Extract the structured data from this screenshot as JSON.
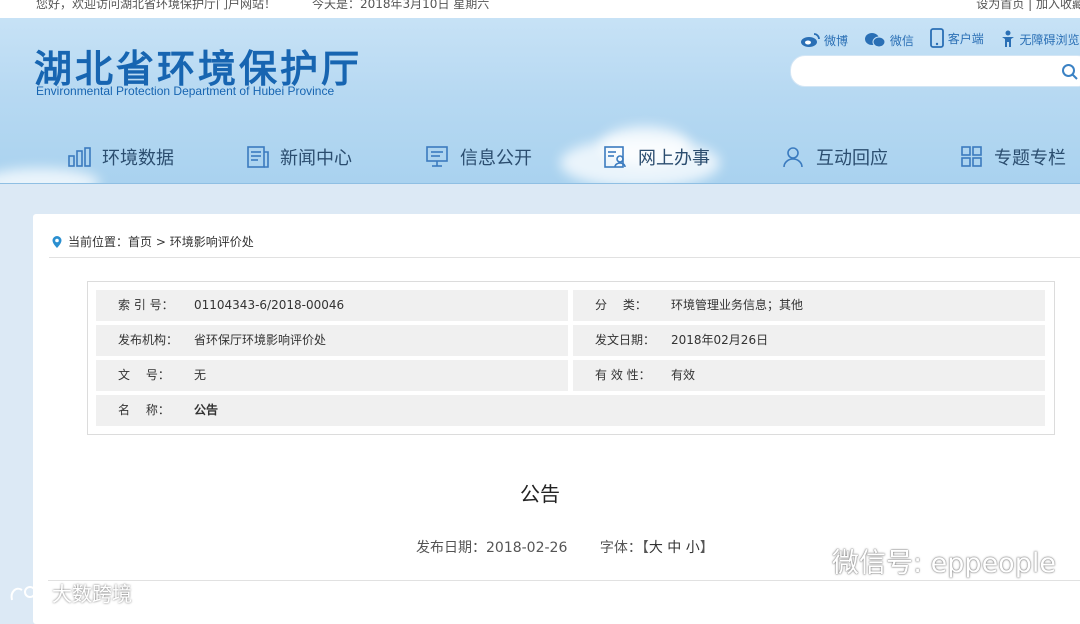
{
  "topbar": {
    "welcome": "您好，欢迎访问湖北省环境保护厅门户网站！",
    "date": "今天是：2018年3月10日 星期六",
    "set_home": "设为首页",
    "separator": " | ",
    "add_fav": "加入收藏"
  },
  "header": {
    "title": "湖北省环境保护厅",
    "subtitle": "Environmental Protection Department of Hubei Province",
    "quicklinks": [
      {
        "label": "微博",
        "icon": "weibo-icon"
      },
      {
        "label": "微信",
        "icon": "wechat-icon"
      },
      {
        "label": "客户端",
        "icon": "mobile-icon"
      },
      {
        "label": "无障碍浏览",
        "icon": "accessibility-icon"
      }
    ],
    "search_placeholder": ""
  },
  "nav": {
    "items": [
      {
        "label": "环境数据",
        "icon": "bar-chart-icon"
      },
      {
        "label": "新闻中心",
        "icon": "news-icon"
      },
      {
        "label": "信息公开",
        "icon": "monitor-icon"
      },
      {
        "label": "网上办事",
        "icon": "id-card-icon"
      },
      {
        "label": "互动回应",
        "icon": "user-icon"
      },
      {
        "label": "专题专栏",
        "icon": "grid-icon"
      }
    ]
  },
  "breadcrumb": {
    "prefix": "当前位置：",
    "home": "首页",
    "sep": " > ",
    "current": "环境影响评价处"
  },
  "info": {
    "index_label": "索 引 号：",
    "index_value": "01104343-6/2018-00046",
    "category_label": "分　 类：",
    "category_value": "环境管理业务信息；其他",
    "publisher_label": "发布机构：",
    "publisher_value": "省环保厅环境影响评价处",
    "date_label": "发文日期：",
    "date_value": "2018年02月26日",
    "docno_label": "文　 号：",
    "docno_value": "无",
    "validity_label": "有 效 性：",
    "validity_value": "有效",
    "name_label": "名　 称：",
    "name_value": "公告"
  },
  "document": {
    "title": "公告",
    "publish_date": "发布日期：2018-02-26",
    "font_label": "字体：",
    "font_open": "【",
    "font_large": "大",
    "font_medium": "中",
    "font_small": "小",
    "font_close": "】"
  },
  "watermarks": {
    "wechat_id": "微信号: eppeople",
    "brand": "大数跨境"
  },
  "colors": {
    "brand_blue": "#1765b1",
    "header_bg": "#b7d9f2",
    "nav_text": "#2b4d6f",
    "info_cell_bg": "#f0f0f0"
  }
}
